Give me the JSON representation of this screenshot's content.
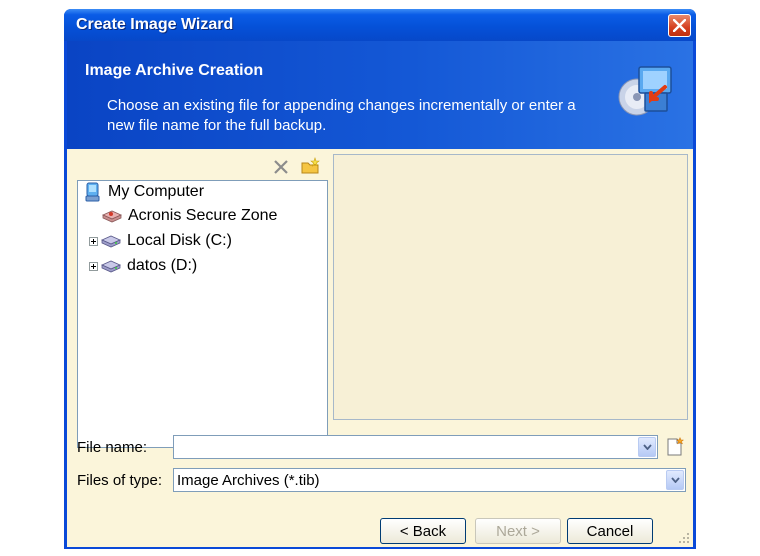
{
  "window": {
    "title": "Create Image Wizard"
  },
  "header": {
    "title": "Image Archive Creation",
    "description": "Choose an existing file for appending changes incrementally or enter a new file name for the full backup."
  },
  "icons": {
    "delete": "x-icon",
    "new_folder": "new-folder-icon",
    "computer": "my-computer-icon",
    "drive": "drive-icon",
    "new_file": "new-file-icon",
    "wizard": "wizard-backup-icon"
  },
  "tree": {
    "root": "My Computer",
    "items": [
      {
        "label": "Acronis Secure Zone",
        "expandable": false
      },
      {
        "label": "Local Disk (C:)",
        "expandable": true
      },
      {
        "label": "datos (D:)",
        "expandable": true
      }
    ]
  },
  "filename": {
    "label": "File name:",
    "value": ""
  },
  "filetype": {
    "label": "Files of type:",
    "value": "Image Archives (*.tib)"
  },
  "buttons": {
    "back": "< Back",
    "next": "Next >",
    "cancel": "Cancel"
  },
  "colors": {
    "title_bar": "#0551d8",
    "header": "#1458d6",
    "panel": "#fbf5da",
    "close": "#d5401f"
  }
}
